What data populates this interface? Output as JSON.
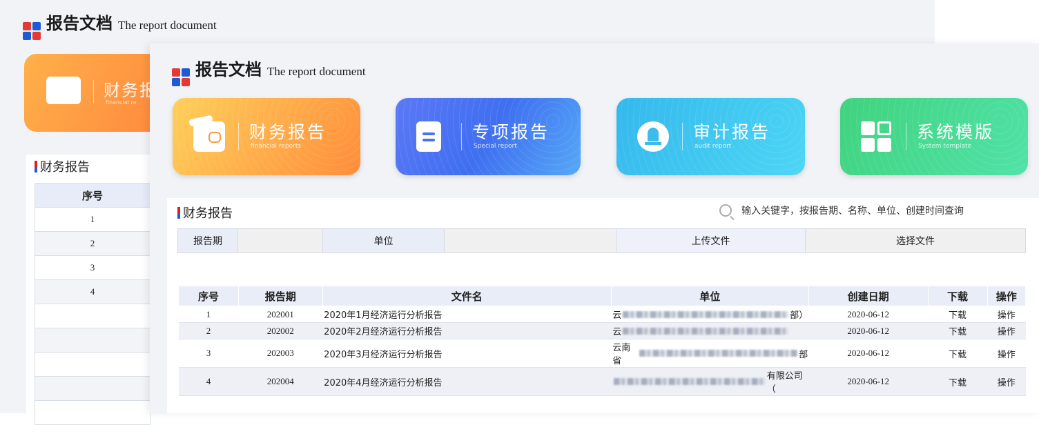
{
  "header": {
    "title_cn": "报告文档",
    "title_en": "The report document"
  },
  "back_window": {
    "card": {
      "label": "财务报",
      "sub": "financial re"
    },
    "section_title": "财务报告",
    "table": {
      "header": "序号",
      "rows": [
        "1",
        "2",
        "3",
        "4",
        "",
        "",
        "",
        "",
        ""
      ]
    }
  },
  "cards": [
    {
      "label": "财务报告",
      "sub": "financial reports",
      "icon": "wallet-icon"
    },
    {
      "label": "专项报告",
      "sub": "Special report",
      "icon": "document-icon"
    },
    {
      "label": "审计报告",
      "sub": "audit report",
      "icon": "stamp-icon"
    },
    {
      "label": "系统模版",
      "sub": "System template",
      "icon": "grid-icon"
    }
  ],
  "section": {
    "title": "财务报告",
    "search_hint": "输入关键字，按报告期、名称、单位、创建时间查询"
  },
  "filter": {
    "period_label": "报告期",
    "period_value": "",
    "unit_label": "单位",
    "unit_value": "",
    "upload_label": "上传文件",
    "choose_label": "选择文件"
  },
  "table": {
    "columns": [
      "序号",
      "报告期",
      "文件名",
      "单位",
      "创建日期",
      "下载",
      "操作"
    ],
    "rows": [
      {
        "index": "1",
        "period": "202001",
        "filename": "2020年1月经济运行分析报告",
        "unit_prefix": "云",
        "unit_suffix": "部）",
        "date": "2020-06-12",
        "download": "下载",
        "action": "操作"
      },
      {
        "index": "2",
        "period": "202002",
        "filename": "2020年2月经济运行分析报告",
        "unit_prefix": "云",
        "unit_suffix": "",
        "date": "2020-06-12",
        "download": "下载",
        "action": "操作"
      },
      {
        "index": "3",
        "period": "202003",
        "filename": "2020年3月经济运行分析报告",
        "unit_prefix": "云南省",
        "unit_suffix": "部",
        "date": "2020-06-12",
        "download": "下载",
        "action": "操作"
      },
      {
        "index": "4",
        "period": "202004",
        "filename": "2020年4月经济运行分析报告",
        "unit_prefix": "",
        "unit_suffix": "有限公司（",
        "date": "2020-06-12",
        "download": "下载",
        "action": "操作"
      }
    ]
  },
  "colors": {
    "orange": "#ff9a3d",
    "blue": "#4a72f2",
    "cyan": "#3dbbe9",
    "green": "#42d58a",
    "accent_red": "#e02020",
    "accent_blue": "#1e5ad6"
  }
}
